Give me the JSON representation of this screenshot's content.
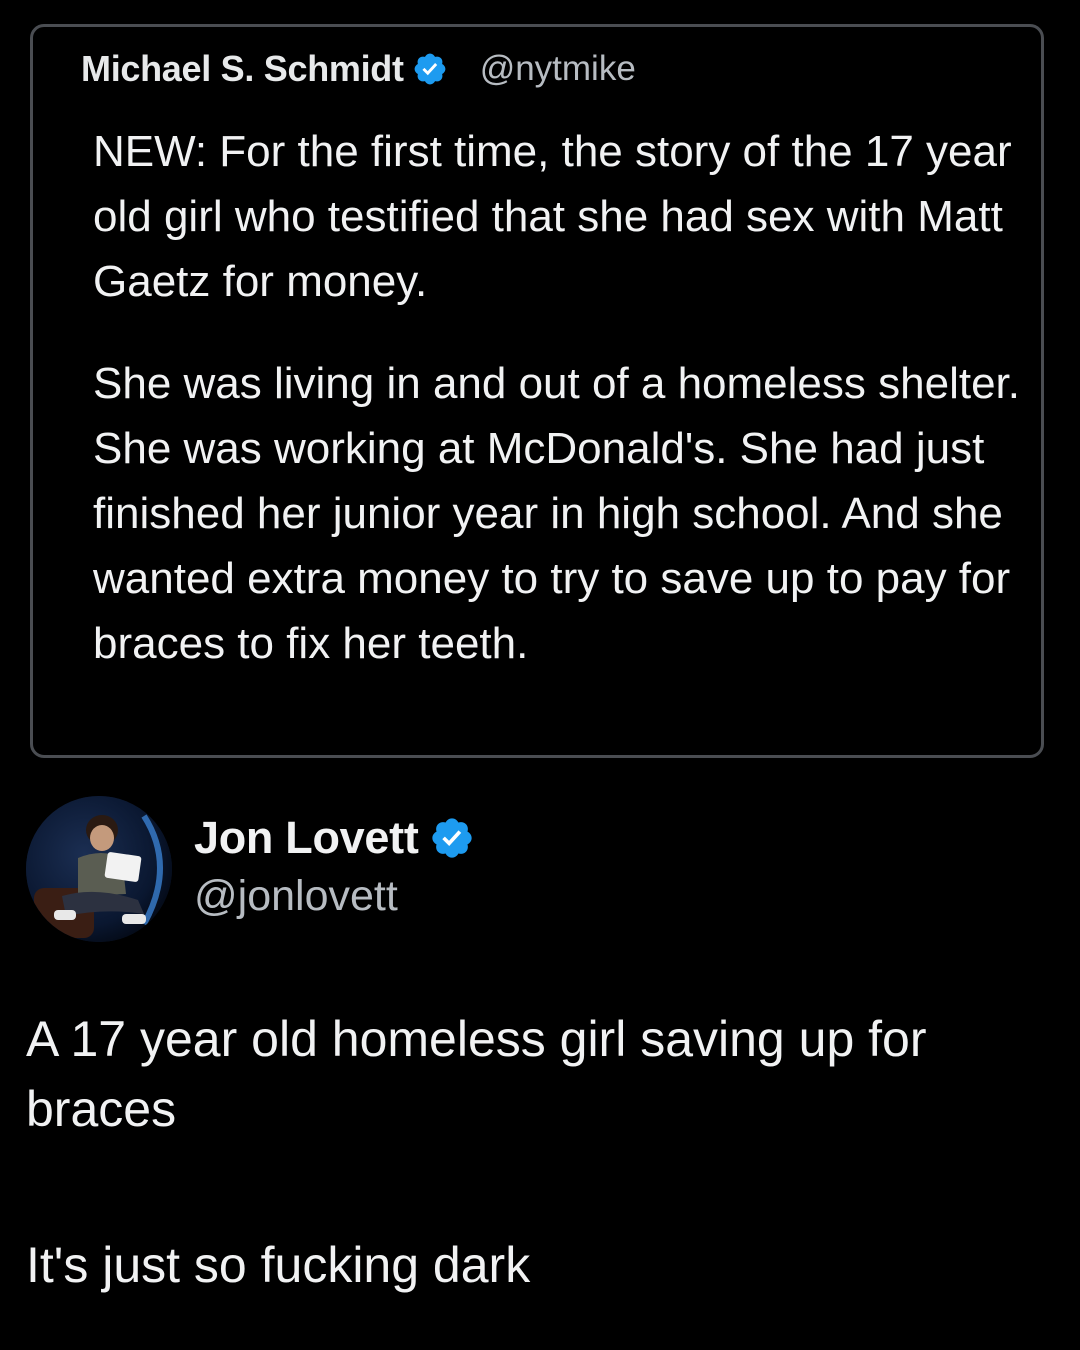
{
  "quoted_tweet": {
    "author_name": "Michael S. Schmidt",
    "author_handle": "@nytmike",
    "verified_icon": "verified-badge-icon",
    "paragraph_1": "NEW:  For the first time, the story of the 17 year old girl who testified that she had sex with Matt Gaetz for money.",
    "paragraph_2": "She was living in and out of a homeless shelter. She was working at McDonald's. She had just finished her junior year in high school. And she wanted extra money to try to save up to pay for braces to fix her teeth."
  },
  "tweet": {
    "author_name": "Jon Lovett",
    "author_handle": "@jonlovett",
    "verified_icon": "verified-badge-icon",
    "avatar_icon": "user-avatar",
    "line_1": "A 17 year old homeless girl saving up for braces",
    "line_2": "It's just so fucking dark"
  },
  "colors": {
    "background": "#000000",
    "text": "#f1f2f3",
    "handle": "#b7bcc2",
    "border": "#4a4d52",
    "verified": "#1d9bf0"
  }
}
